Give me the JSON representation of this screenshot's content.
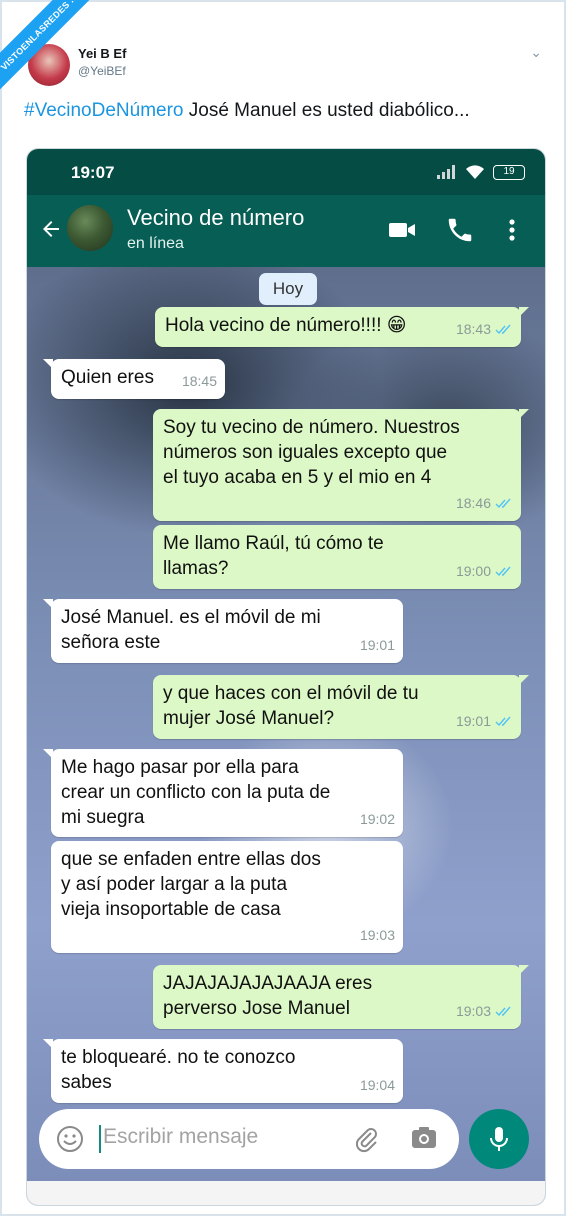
{
  "ribbon": {
    "text": "VISTOENLASREDES .com"
  },
  "tweet": {
    "display_name": "Yei B Ef",
    "handle": "@YeiBEf",
    "hashtag": "#VecinoDeNúmero",
    "text": " José Manuel es usted diabólico..."
  },
  "phone": {
    "time": "19:07",
    "battery": "19"
  },
  "chat_header": {
    "contact_name": "Vecino de número",
    "status": "en línea"
  },
  "chat": {
    "date_pill": "Hoy",
    "messages": [
      {
        "dir": "out",
        "text": "Hola vecino de número!!!! 😁",
        "time": "18:43"
      },
      {
        "dir": "in",
        "text": "Quien eres",
        "time": "18:45"
      },
      {
        "dir": "out",
        "text": "Soy tu vecino de número. Nuestros números son iguales excepto que el tuyo acaba en 5 y el mio en 4",
        "time": "18:46"
      },
      {
        "dir": "out",
        "text": "Me llamo Raúl, tú cómo te llamas?",
        "time": "19:00"
      },
      {
        "dir": "in",
        "text": "José Manuel. es el móvil de mi señora este",
        "time": "19:01"
      },
      {
        "dir": "out",
        "text": "y que haces con el móvil de tu mujer José Manuel?",
        "time": "19:01"
      },
      {
        "dir": "in",
        "text": "Me hago pasar por ella para crear un conflicto con la puta de mi suegra",
        "time": "19:02"
      },
      {
        "dir": "in",
        "text": "que se enfaden entre ellas dos y así poder largar a la puta vieja insoportable de casa",
        "time": "19:03"
      },
      {
        "dir": "out",
        "text": "JAJAJAJAJAJAAJA eres perverso Jose Manuel",
        "time": "19:03"
      },
      {
        "dir": "in",
        "text": "te bloquearé. no te conozco sabes",
        "time": "19:04"
      }
    ]
  },
  "input": {
    "placeholder": "Escribir mensaje"
  },
  "colors": {
    "header": "#075e54",
    "outgoing_bubble": "#dcf8c6",
    "incoming_bubble": "#ffffff",
    "read_ticks": "#4fc3f7",
    "mic_button": "#00897b",
    "hashtag": "#1b95e0"
  },
  "icons": [
    "back-arrow-icon",
    "video-call-icon",
    "phone-call-icon",
    "more-vert-icon",
    "emoji-icon",
    "attach-clip-icon",
    "camera-icon",
    "microphone-icon",
    "signal-icon",
    "wifi-icon",
    "battery-icon",
    "read-receipt-icon",
    "chevron-down-icon"
  ]
}
